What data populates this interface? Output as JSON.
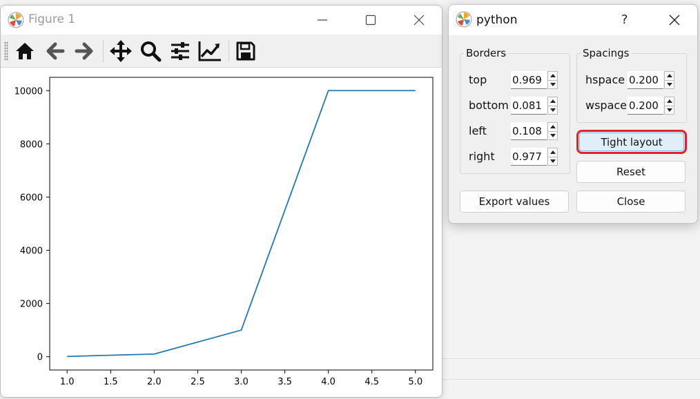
{
  "figure_window": {
    "title": "Figure 1",
    "controls": {
      "minimize": "minimize-icon",
      "maximize": "maximize-icon",
      "close": "close-icon"
    },
    "toolbar": [
      "home-icon",
      "back-arrow-icon",
      "forward-arrow-icon",
      "pan-move-icon",
      "zoom-magnifier-icon",
      "configure-subplots-icon",
      "edit-axis-icon",
      "save-disk-icon"
    ]
  },
  "dialog": {
    "title": "python",
    "help": "?",
    "borders": {
      "title": "Borders",
      "fields": [
        {
          "label": "top",
          "value": "0.969"
        },
        {
          "label": "bottom",
          "value": "0.081"
        },
        {
          "label": "left",
          "value": "0.108"
        },
        {
          "label": "right",
          "value": "0.977"
        }
      ]
    },
    "spacings": {
      "title": "Spacings",
      "fields": [
        {
          "label": "hspace",
          "value": "0.200"
        },
        {
          "label": "wspace",
          "value": "0.200"
        }
      ]
    },
    "buttons": {
      "tight_layout": "Tight layout",
      "reset": "Reset",
      "export": "Export values",
      "close": "Close"
    }
  },
  "colors": {
    "line": "#1f77b4",
    "highlight_outline": "#e0202a",
    "tight_layout_bg": "#e0eef9"
  },
  "chart_data": {
    "type": "line",
    "x": [
      1.0,
      2.0,
      3.0,
      4.0,
      5.0
    ],
    "series": [
      {
        "values": [
          10,
          100,
          1000,
          10000,
          10000
        ]
      }
    ],
    "xlim": [
      0.8,
      5.2
    ],
    "ylim": [
      -500,
      10500
    ],
    "xticks": [
      "1.0",
      "1.5",
      "2.0",
      "2.5",
      "3.0",
      "3.5",
      "4.0",
      "4.5",
      "5.0"
    ],
    "yticks": [
      "0",
      "2000",
      "4000",
      "6000",
      "8000",
      "10000"
    ],
    "grid": false
  }
}
